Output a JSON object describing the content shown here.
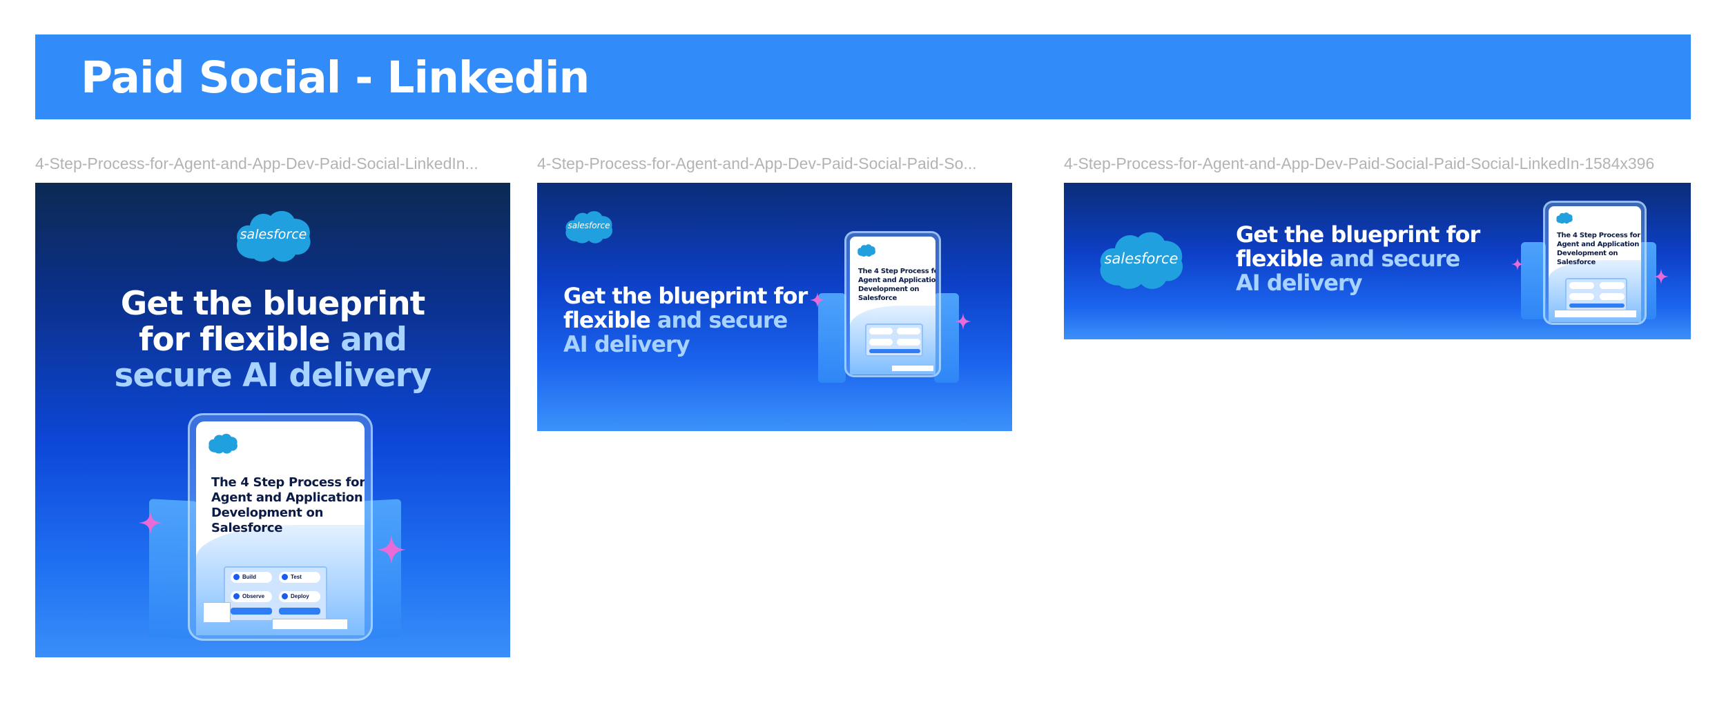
{
  "header": {
    "title": "Paid Social - Linkedin"
  },
  "frames": [
    {
      "label": "4-Step-Process-for-Agent-and-App-Dev-Paid-Social-LinkedIn..."
    },
    {
      "label": "4-Step-Process-for-Agent-and-App-Dev-Paid-Social-Paid-So..."
    },
    {
      "label": "4-Step-Process-for-Agent-and-App-Dev-Paid-Social-Paid-Social-LinkedIn-1584x396"
    }
  ],
  "ad": {
    "logo_text": "salesforce",
    "square_headline": {
      "line1": "Get the blueprint",
      "line2_white": "for flexible ",
      "line2_light": "and",
      "line3_light": "secure AI delivery"
    },
    "wide_headline": {
      "line1": "Get the blueprint for",
      "line2_white": "flexible ",
      "line2_light": "and secure",
      "line3_light": "AI delivery"
    },
    "ebook": {
      "line1": "The 4 Step Process for",
      "line2": "Agent and Application",
      "line3": "Development on",
      "line4": "Salesforce"
    },
    "flow_steps": [
      "Build",
      "Test",
      "Observe",
      "Deploy"
    ]
  },
  "colors": {
    "header_bg": "#318bf8",
    "headline_light": "#a8d2ff",
    "label_gray": "#b3b3b3"
  }
}
